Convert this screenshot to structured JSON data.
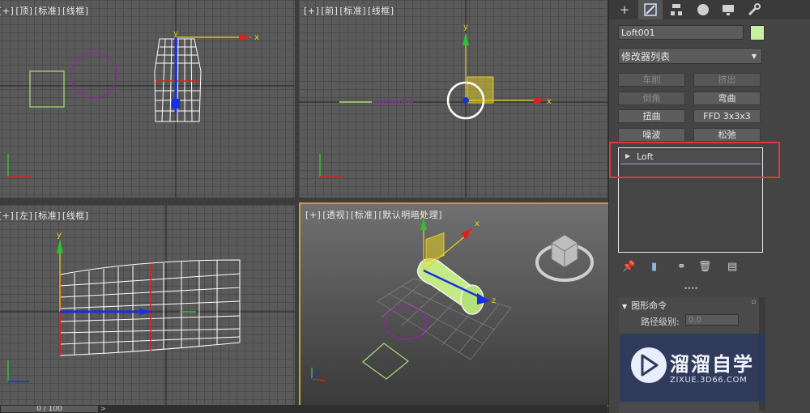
{
  "viewports": {
    "top": {
      "labels": [
        "[+]",
        "[顶]",
        "[标准]",
        "[线框]"
      ]
    },
    "front": {
      "labels": [
        "[+]",
        "[前]",
        "[标准]",
        "[线框]"
      ]
    },
    "left": {
      "labels": [
        "[+]",
        "[左]",
        "[标准]",
        "[线框]"
      ]
    },
    "persp": {
      "labels": [
        "[+]",
        "[透视]",
        "[标准]",
        "[默认明暗处理]"
      ]
    },
    "axis_x": "x",
    "axis_y": "y",
    "axis_z": "z"
  },
  "command_panel": {
    "tabs": [
      "create-icon",
      "modify-icon",
      "hierarchy-icon",
      "motion-icon",
      "display-icon",
      "utilities-icon"
    ],
    "active_tab": 1,
    "object_name": "Loft001",
    "object_color": "#c8f0a0",
    "modifier_list": "修改器列表",
    "modifier_buttons": [
      {
        "label": "车削",
        "enabled": false
      },
      {
        "label": "挤出",
        "enabled": false
      },
      {
        "label": "倒角",
        "enabled": false
      },
      {
        "label": "弯曲",
        "enabled": true
      },
      {
        "label": "扭曲",
        "enabled": true
      },
      {
        "label": "FFD 3x3x3",
        "enabled": true
      },
      {
        "label": "噪波",
        "enabled": true
      },
      {
        "label": "松弛",
        "enabled": true
      }
    ],
    "stack_item": "Loft",
    "rollout_title": "图形命令",
    "path_level_label": "路径级别:",
    "path_level_value": "0.0"
  },
  "watermark": {
    "title": "溜溜自学",
    "url": "ZIXUE.3D66.COM"
  },
  "timeline": {
    "frame": "0 / 100"
  },
  "colors": {
    "highlight": "#d93a3a",
    "active_viewport_border": "#c8a037",
    "selection": "#ffffff"
  }
}
